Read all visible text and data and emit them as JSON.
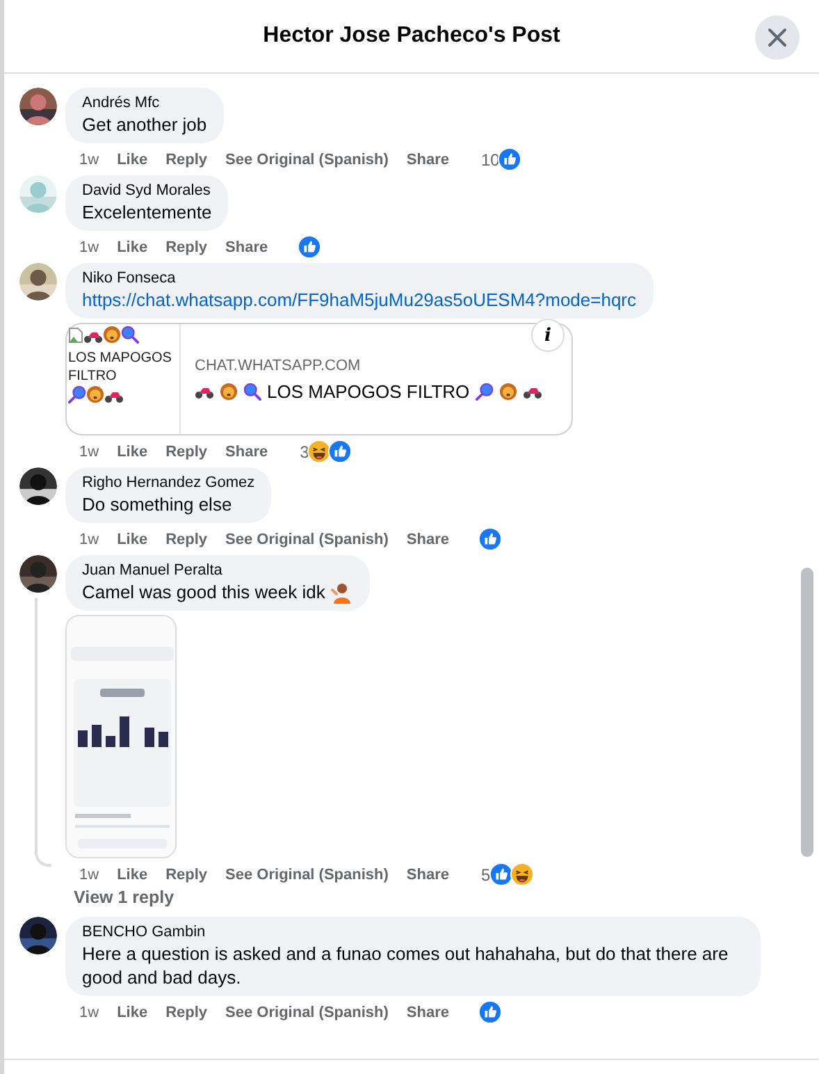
{
  "dialog": {
    "title": "Hector Jose Pacheco's Post"
  },
  "comments": [
    {
      "author": "Andrés Mfc",
      "text": "Get another job",
      "kind": "plain",
      "time": "1w",
      "actions": [
        "Like",
        "Reply",
        "See Original (Spanish)",
        "Share"
      ],
      "reaction_count": "10",
      "reactions": [
        {
          "kind": "like"
        }
      ]
    },
    {
      "author": "David Syd Morales",
      "text": "Excelentemente",
      "kind": "plain",
      "time": "1w",
      "actions": [
        "Like",
        "Reply",
        "Share"
      ],
      "reactions": [
        {
          "kind": "like"
        }
      ]
    },
    {
      "author": "Niko Fonseca",
      "text": "https://chat.whatsapp.com/FF9haM5juMu29as5oUESM4?mode=hqrc",
      "kind": "link",
      "attachment": {
        "kind": "link_preview",
        "thumbnail_alt": "LOS MAPOGOS FILTRO",
        "domain": "CHAT.WHATSAPP.COM",
        "title": "LOS MAPOGOS FILTRO",
        "info_label": "i"
      },
      "time": "1w",
      "actions": [
        "Like",
        "Reply",
        "Share"
      ],
      "reaction_count": "3",
      "reactions": [
        {
          "kind": "haha"
        },
        {
          "kind": "like"
        }
      ]
    },
    {
      "author": "Righo Hernandez Gomez",
      "text": "Do something else",
      "kind": "plain",
      "time": "1w",
      "actions": [
        "Like",
        "Reply",
        "See Original (Spanish)",
        "Share"
      ],
      "reactions": [
        {
          "kind": "like"
        }
      ]
    },
    {
      "author": "Juan Manuel Peralta",
      "text": "Camel was good this week idk",
      "kind": "plain",
      "emoji": {
        "kind": "person"
      },
      "attachment": {
        "kind": "picture"
      },
      "time": "1w",
      "actions": [
        "Like",
        "Reply",
        "See Original (Spanish)",
        "Share"
      ],
      "reaction_count": "5",
      "reactions": [
        {
          "kind": "like"
        },
        {
          "kind": "haha"
        }
      ],
      "view_replies": "View 1 reply"
    },
    {
      "author": "BENCHO Gambin",
      "text": "Here a question is asked and a funao comes out hahahaha, but do that there are good and bad days.",
      "kind": "plain",
      "time": "1w",
      "actions": [
        "Like",
        "Reply",
        "See Original (Spanish)",
        "Share"
      ],
      "reactions": [
        {
          "kind": "like"
        }
      ]
    }
  ]
}
